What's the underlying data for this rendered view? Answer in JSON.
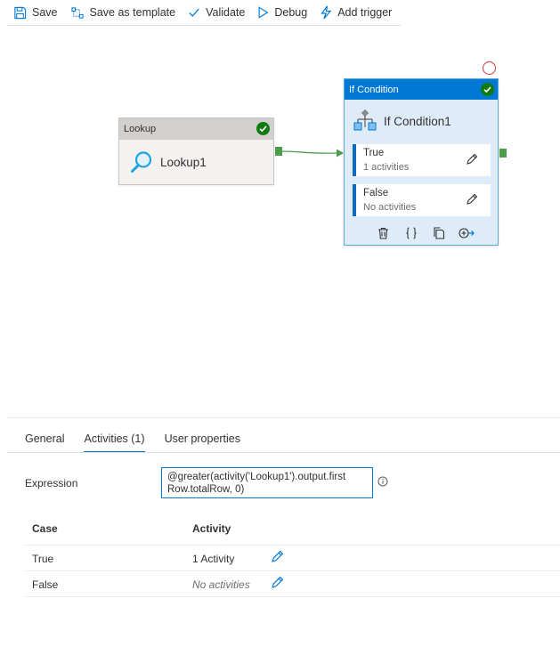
{
  "toolbar": {
    "save": "Save",
    "save_template": "Save as template",
    "validate": "Validate",
    "debug": "Debug",
    "add_trigger": "Add trigger"
  },
  "lookup_node": {
    "type_label": "Lookup",
    "name": "Lookup1"
  },
  "if_node": {
    "type_label": "If Condition",
    "name": "If Condition1",
    "branches": [
      {
        "name": "True",
        "summary": "1 activities"
      },
      {
        "name": "False",
        "summary": "No activities"
      }
    ]
  },
  "tabs": [
    {
      "label": "General",
      "active": false
    },
    {
      "label": "Activities (1)",
      "active": true
    },
    {
      "label": "User properties",
      "active": false
    }
  ],
  "properties": {
    "expression_label": "Expression",
    "expression_line1": "@greater(activity('Lookup1').output.first",
    "expression_line2": "Row.totalRow, 0)",
    "table": {
      "headers": {
        "case": "Case",
        "activity": "Activity"
      },
      "rows": [
        {
          "case": "True",
          "activity": "1 Activity"
        },
        {
          "case": "False",
          "activity": "No activities"
        }
      ]
    }
  },
  "colors": {
    "accent": "#0078d4",
    "success": "#107c10",
    "error": "#d13438",
    "connector": "#4a9d4a"
  }
}
